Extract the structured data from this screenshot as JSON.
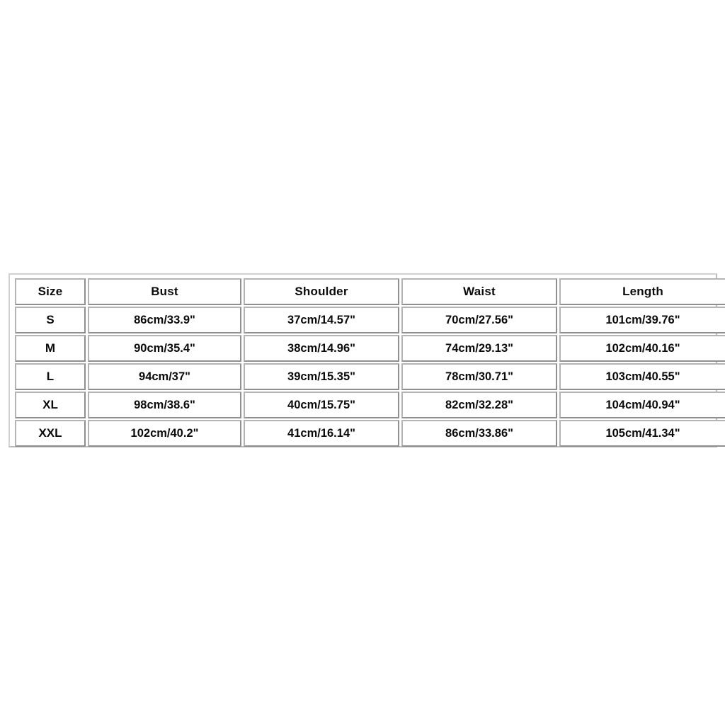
{
  "table": {
    "name": "size-chart",
    "columns": [
      "Size",
      "Bust",
      "Shoulder",
      "Waist",
      "Length"
    ],
    "rows": [
      {
        "size": "S",
        "bust": "86cm/33.9\"",
        "shoulder": "37cm/14.57\"",
        "waist": "70cm/27.56\"",
        "length": "101cm/39.76\""
      },
      {
        "size": "M",
        "bust": "90cm/35.4\"",
        "shoulder": "38cm/14.96\"",
        "waist": "74cm/29.13\"",
        "length": "102cm/40.16\""
      },
      {
        "size": "L",
        "bust": "94cm/37\"",
        "shoulder": "39cm/15.35\"",
        "waist": "78cm/30.71\"",
        "length": "103cm/40.55\""
      },
      {
        "size": "XL",
        "bust": "98cm/38.6\"",
        "shoulder": "40cm/15.75\"",
        "waist": "82cm/32.28\"",
        "length": "104cm/40.94\""
      },
      {
        "size": "XXL",
        "bust": "102cm/40.2\"",
        "shoulder": "41cm/16.14\"",
        "waist": "86cm/33.86\"",
        "length": "105cm/41.34\""
      }
    ]
  },
  "colors": {
    "page_background": "#ffffff",
    "cell_background": "#ffffff",
    "text": "#0b0b0b",
    "cell_border": "#9d9d9d",
    "frame_border": "#c8c8c8"
  }
}
